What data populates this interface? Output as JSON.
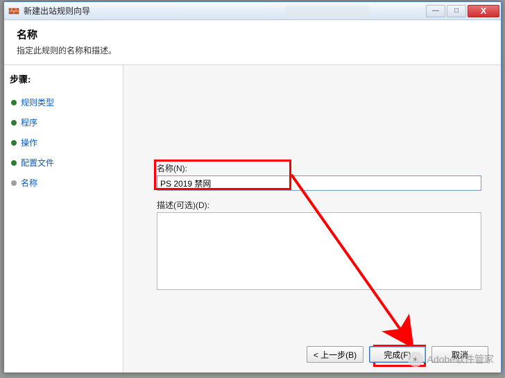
{
  "window": {
    "title": "新建出站规则向导",
    "close": "X",
    "minimize": "—",
    "maximize": "□"
  },
  "header": {
    "title": "名称",
    "subtitle": "指定此规则的名称和描述。"
  },
  "sidebar": {
    "steps_title": "步骤:",
    "items": [
      {
        "label": "规则类型"
      },
      {
        "label": "程序"
      },
      {
        "label": "操作"
      },
      {
        "label": "配置文件"
      },
      {
        "label": "名称"
      }
    ]
  },
  "form": {
    "name_label": "名称(N):",
    "name_value": "PS 2019 禁网",
    "desc_label": "描述(可选)(D):",
    "desc_value": ""
  },
  "buttons": {
    "back": "< 上一步(B)",
    "finish": "完成(F)",
    "cancel": "取消"
  },
  "watermark": {
    "text": "Adobe软件管家"
  }
}
